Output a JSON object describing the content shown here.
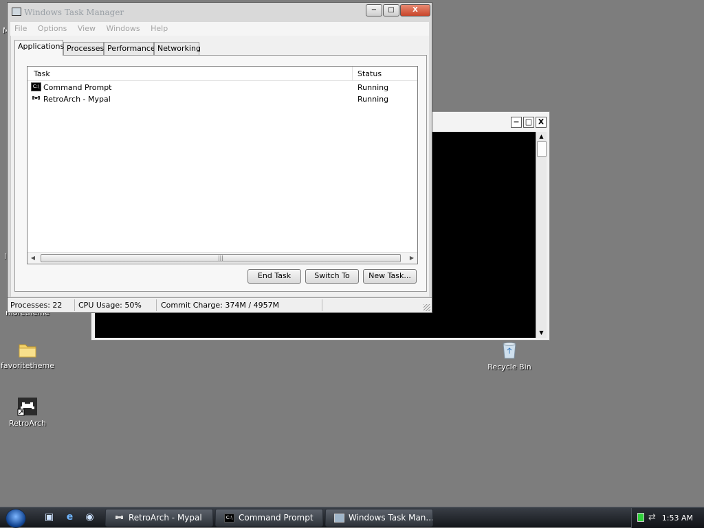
{
  "task_manager": {
    "title": "Windows Task Manager",
    "controls": {
      "minimize": "−",
      "maximize": "□",
      "close": "X"
    },
    "menu": [
      "File",
      "Options",
      "View",
      "Windows",
      "Help"
    ],
    "tabs": [
      "Applications",
      "Processes",
      "Performance",
      "Networking"
    ],
    "active_tab": "Applications",
    "columns": {
      "task": "Task",
      "status": "Status"
    },
    "rows": [
      {
        "task": "Command Prompt",
        "status": "Running",
        "icon": "cmd-icon"
      },
      {
        "task": "RetroArch - Mypal",
        "status": "Running",
        "icon": "retroarch-icon"
      }
    ],
    "buttons": {
      "end_task": "End Task",
      "switch_to": "Switch To",
      "new_task": "New Task..."
    },
    "status_bar": {
      "processes": "Processes: 22",
      "cpu": "CPU Usage: 50%",
      "commit": "Commit Charge: 374M / 4957M"
    }
  },
  "desktop": {
    "icons": [
      {
        "label": "favoritetheme",
        "icon": "folder-icon"
      },
      {
        "label": "RetroArch",
        "icon": "retroarch-shortcut-icon"
      },
      {
        "label": "Recycle Bin",
        "icon": "recycle-bin-icon"
      }
    ],
    "partial_labels": [
      "M",
      "l",
      "moretheme"
    ]
  },
  "taskbar": {
    "quick_launch": [
      "show-desktop-icon",
      "internet-explorer-icon",
      "media-player-icon"
    ],
    "buttons": [
      "RetroArch - Mypal",
      "Command Prompt",
      "Windows Task Man..."
    ],
    "clock": "1:53 AM",
    "tray_icons": [
      "battery-icon",
      "network-icon"
    ]
  },
  "colors": {
    "desktop": "#7d7d7d",
    "close_button": "#c8452a",
    "console_bg": "#000000"
  }
}
